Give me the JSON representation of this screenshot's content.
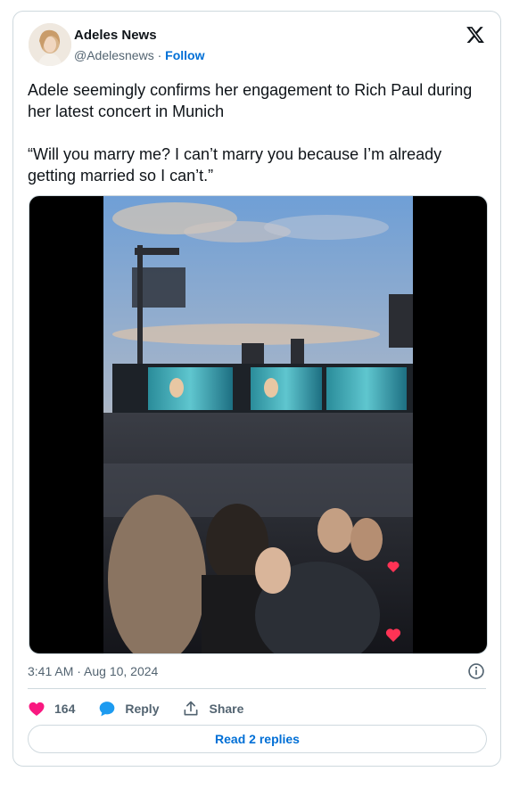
{
  "author": {
    "name": "Adeles News",
    "handle": "@Adelesnews",
    "separator": "·",
    "follow_label": "Follow"
  },
  "tweet": {
    "text": "Adele seemingly confirms her engagement to Rich Paul during her latest concert in Munich\n\n“Will you marry me? I can’t marry you because I’m already getting married so I can’t.”",
    "timestamp": "3:41 AM · Aug 10, 2024"
  },
  "actions": {
    "likes": "164",
    "reply_label": "Reply",
    "share_label": "Share"
  },
  "read_replies_label": "Read 2 replies",
  "icons": {
    "logo": "x-logo-icon",
    "info": "info-icon",
    "like": "heart-icon",
    "reply": "reply-bubble-icon",
    "share": "share-icon"
  },
  "colors": {
    "like": "#f91880",
    "reply": "#1d9bf0",
    "link": "#006fd6",
    "secondary_text": "#536471",
    "border": "#cfd9de"
  }
}
